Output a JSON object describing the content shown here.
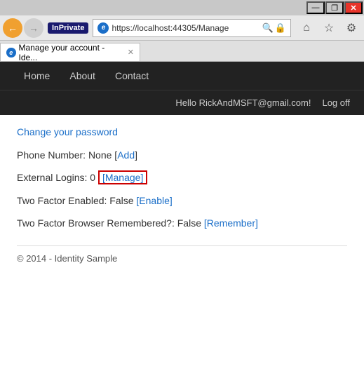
{
  "titlebar": {
    "minimize_label": "—",
    "restore_label": "❐",
    "close_label": "✕"
  },
  "toolbar": {
    "back_icon": "←",
    "forward_icon": "→",
    "inprivate_label": "InPrivate",
    "ie_icon_label": "e",
    "address_url": "https://localhost:44305/Manage",
    "search_icon": "🔍",
    "lock_icon": "🔒",
    "home_icon": "⌂",
    "star_icon": "☆",
    "gear_icon": "⚙"
  },
  "tab": {
    "ie_icon_label": "e",
    "title": "Manage your account - Ide...",
    "close_label": "✕"
  },
  "navbar": {
    "links": [
      {
        "label": "Home"
      },
      {
        "label": "About"
      },
      {
        "label": "Contact"
      }
    ]
  },
  "hellobar": {
    "greeting": "Hello RickAndMSFT@gmail.com!",
    "logoff_label": "Log off"
  },
  "main": {
    "page_title": "...",
    "change_password_label": "Change your password",
    "phone_row": "Phone Number: None [",
    "phone_add": "Add",
    "phone_row_end": "]",
    "external_label": "External Logins: 0 ",
    "external_manage": "[Manage]",
    "twofactor_label": "Two Factor Enabled: False ",
    "twofactor_enable": "[Enable]",
    "twofa_browser_label": "Two Factor Browser Remembered?: False ",
    "twofa_remember": "[Remember]"
  },
  "footer": {
    "text": "© 2014 - Identity Sample"
  }
}
